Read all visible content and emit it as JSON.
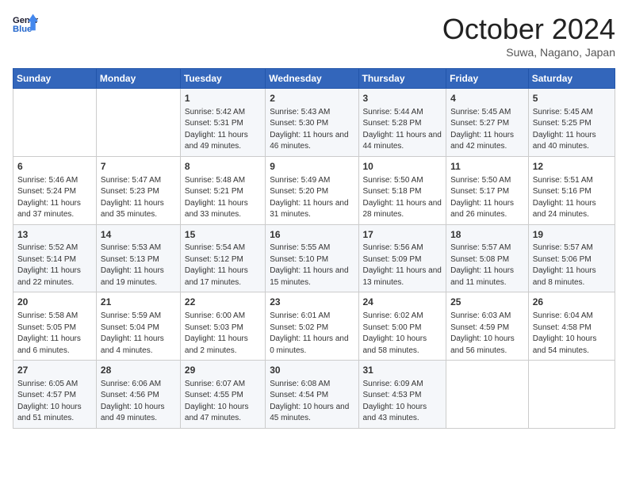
{
  "header": {
    "logo_line1": "General",
    "logo_line2": "Blue",
    "month": "October 2024",
    "location": "Suwa, Nagano, Japan"
  },
  "weekdays": [
    "Sunday",
    "Monday",
    "Tuesday",
    "Wednesday",
    "Thursday",
    "Friday",
    "Saturday"
  ],
  "weeks": [
    [
      {
        "day": "",
        "sunrise": "",
        "sunset": "",
        "daylight": ""
      },
      {
        "day": "",
        "sunrise": "",
        "sunset": "",
        "daylight": ""
      },
      {
        "day": "1",
        "sunrise": "Sunrise: 5:42 AM",
        "sunset": "Sunset: 5:31 PM",
        "daylight": "Daylight: 11 hours and 49 minutes."
      },
      {
        "day": "2",
        "sunrise": "Sunrise: 5:43 AM",
        "sunset": "Sunset: 5:30 PM",
        "daylight": "Daylight: 11 hours and 46 minutes."
      },
      {
        "day": "3",
        "sunrise": "Sunrise: 5:44 AM",
        "sunset": "Sunset: 5:28 PM",
        "daylight": "Daylight: 11 hours and 44 minutes."
      },
      {
        "day": "4",
        "sunrise": "Sunrise: 5:45 AM",
        "sunset": "Sunset: 5:27 PM",
        "daylight": "Daylight: 11 hours and 42 minutes."
      },
      {
        "day": "5",
        "sunrise": "Sunrise: 5:45 AM",
        "sunset": "Sunset: 5:25 PM",
        "daylight": "Daylight: 11 hours and 40 minutes."
      }
    ],
    [
      {
        "day": "6",
        "sunrise": "Sunrise: 5:46 AM",
        "sunset": "Sunset: 5:24 PM",
        "daylight": "Daylight: 11 hours and 37 minutes."
      },
      {
        "day": "7",
        "sunrise": "Sunrise: 5:47 AM",
        "sunset": "Sunset: 5:23 PM",
        "daylight": "Daylight: 11 hours and 35 minutes."
      },
      {
        "day": "8",
        "sunrise": "Sunrise: 5:48 AM",
        "sunset": "Sunset: 5:21 PM",
        "daylight": "Daylight: 11 hours and 33 minutes."
      },
      {
        "day": "9",
        "sunrise": "Sunrise: 5:49 AM",
        "sunset": "Sunset: 5:20 PM",
        "daylight": "Daylight: 11 hours and 31 minutes."
      },
      {
        "day": "10",
        "sunrise": "Sunrise: 5:50 AM",
        "sunset": "Sunset: 5:18 PM",
        "daylight": "Daylight: 11 hours and 28 minutes."
      },
      {
        "day": "11",
        "sunrise": "Sunrise: 5:50 AM",
        "sunset": "Sunset: 5:17 PM",
        "daylight": "Daylight: 11 hours and 26 minutes."
      },
      {
        "day": "12",
        "sunrise": "Sunrise: 5:51 AM",
        "sunset": "Sunset: 5:16 PM",
        "daylight": "Daylight: 11 hours and 24 minutes."
      }
    ],
    [
      {
        "day": "13",
        "sunrise": "Sunrise: 5:52 AM",
        "sunset": "Sunset: 5:14 PM",
        "daylight": "Daylight: 11 hours and 22 minutes."
      },
      {
        "day": "14",
        "sunrise": "Sunrise: 5:53 AM",
        "sunset": "Sunset: 5:13 PM",
        "daylight": "Daylight: 11 hours and 19 minutes."
      },
      {
        "day": "15",
        "sunrise": "Sunrise: 5:54 AM",
        "sunset": "Sunset: 5:12 PM",
        "daylight": "Daylight: 11 hours and 17 minutes."
      },
      {
        "day": "16",
        "sunrise": "Sunrise: 5:55 AM",
        "sunset": "Sunset: 5:10 PM",
        "daylight": "Daylight: 11 hours and 15 minutes."
      },
      {
        "day": "17",
        "sunrise": "Sunrise: 5:56 AM",
        "sunset": "Sunset: 5:09 PM",
        "daylight": "Daylight: 11 hours and 13 minutes."
      },
      {
        "day": "18",
        "sunrise": "Sunrise: 5:57 AM",
        "sunset": "Sunset: 5:08 PM",
        "daylight": "Daylight: 11 hours and 11 minutes."
      },
      {
        "day": "19",
        "sunrise": "Sunrise: 5:57 AM",
        "sunset": "Sunset: 5:06 PM",
        "daylight": "Daylight: 11 hours and 8 minutes."
      }
    ],
    [
      {
        "day": "20",
        "sunrise": "Sunrise: 5:58 AM",
        "sunset": "Sunset: 5:05 PM",
        "daylight": "Daylight: 11 hours and 6 minutes."
      },
      {
        "day": "21",
        "sunrise": "Sunrise: 5:59 AM",
        "sunset": "Sunset: 5:04 PM",
        "daylight": "Daylight: 11 hours and 4 minutes."
      },
      {
        "day": "22",
        "sunrise": "Sunrise: 6:00 AM",
        "sunset": "Sunset: 5:03 PM",
        "daylight": "Daylight: 11 hours and 2 minutes."
      },
      {
        "day": "23",
        "sunrise": "Sunrise: 6:01 AM",
        "sunset": "Sunset: 5:02 PM",
        "daylight": "Daylight: 11 hours and 0 minutes."
      },
      {
        "day": "24",
        "sunrise": "Sunrise: 6:02 AM",
        "sunset": "Sunset: 5:00 PM",
        "daylight": "Daylight: 10 hours and 58 minutes."
      },
      {
        "day": "25",
        "sunrise": "Sunrise: 6:03 AM",
        "sunset": "Sunset: 4:59 PM",
        "daylight": "Daylight: 10 hours and 56 minutes."
      },
      {
        "day": "26",
        "sunrise": "Sunrise: 6:04 AM",
        "sunset": "Sunset: 4:58 PM",
        "daylight": "Daylight: 10 hours and 54 minutes."
      }
    ],
    [
      {
        "day": "27",
        "sunrise": "Sunrise: 6:05 AM",
        "sunset": "Sunset: 4:57 PM",
        "daylight": "Daylight: 10 hours and 51 minutes."
      },
      {
        "day": "28",
        "sunrise": "Sunrise: 6:06 AM",
        "sunset": "Sunset: 4:56 PM",
        "daylight": "Daylight: 10 hours and 49 minutes."
      },
      {
        "day": "29",
        "sunrise": "Sunrise: 6:07 AM",
        "sunset": "Sunset: 4:55 PM",
        "daylight": "Daylight: 10 hours and 47 minutes."
      },
      {
        "day": "30",
        "sunrise": "Sunrise: 6:08 AM",
        "sunset": "Sunset: 4:54 PM",
        "daylight": "Daylight: 10 hours and 45 minutes."
      },
      {
        "day": "31",
        "sunrise": "Sunrise: 6:09 AM",
        "sunset": "Sunset: 4:53 PM",
        "daylight": "Daylight: 10 hours and 43 minutes."
      },
      {
        "day": "",
        "sunrise": "",
        "sunset": "",
        "daylight": ""
      },
      {
        "day": "",
        "sunrise": "",
        "sunset": "",
        "daylight": ""
      }
    ]
  ]
}
